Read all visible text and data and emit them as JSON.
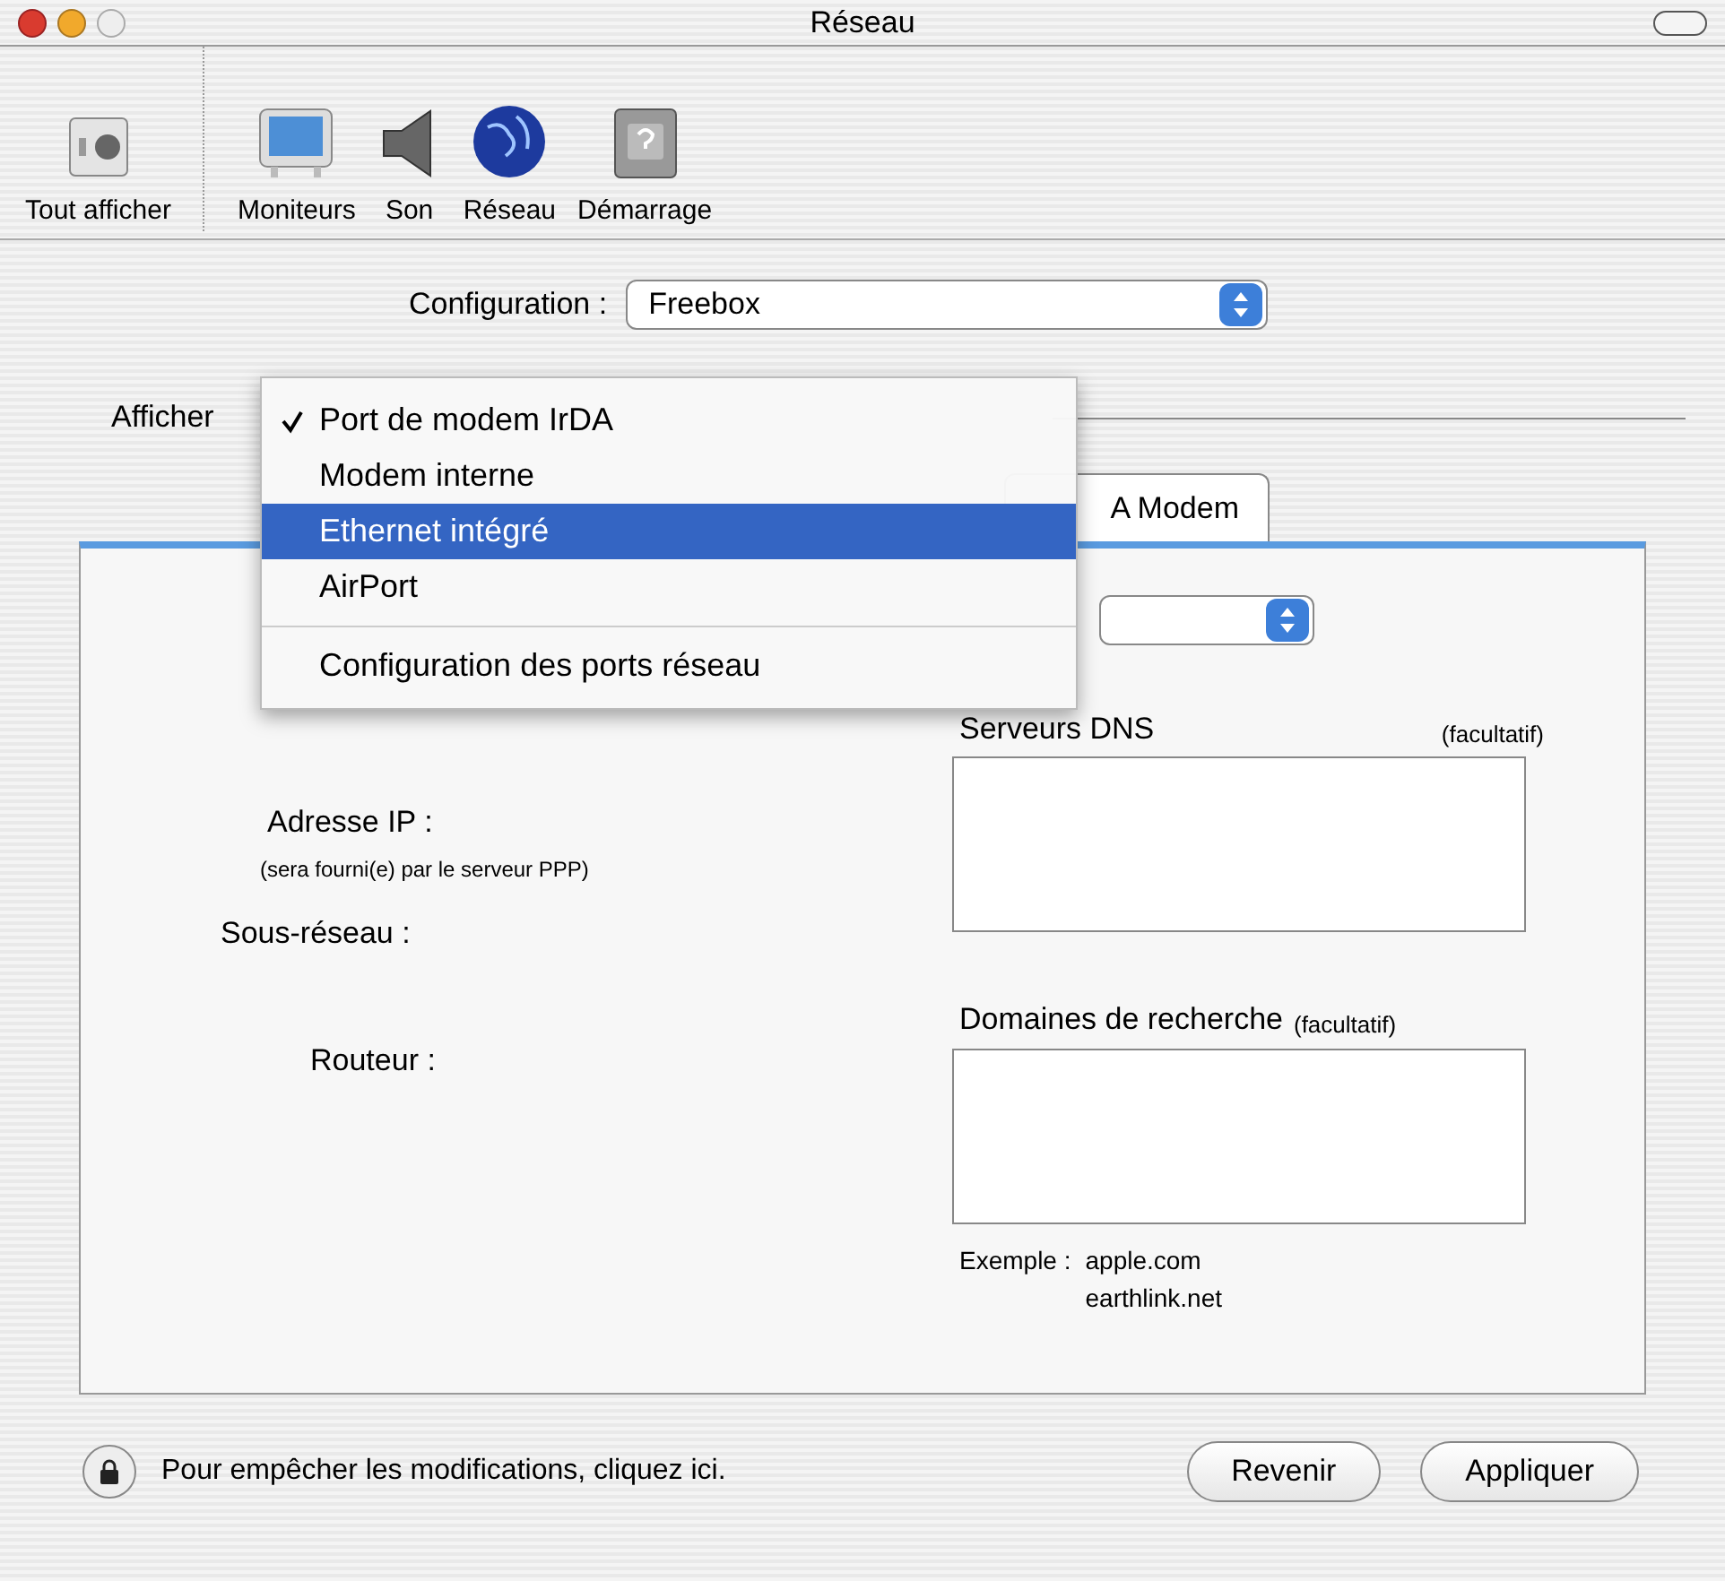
{
  "window": {
    "title": "Réseau"
  },
  "toolbar": {
    "items": [
      {
        "label": "Tout afficher",
        "kind": "general"
      },
      {
        "label": "Moniteurs",
        "kind": "monitor"
      },
      {
        "label": "Son",
        "kind": "speaker"
      },
      {
        "label": "Réseau",
        "kind": "globe"
      },
      {
        "label": "Démarrage",
        "kind": "disk"
      }
    ]
  },
  "configuration": {
    "label": "Configuration :",
    "value": "Freebox"
  },
  "show": {
    "label": "Afficher"
  },
  "menu": {
    "items": [
      {
        "label": "Port de modem IrDA",
        "checked": true,
        "selected": false
      },
      {
        "label": "Modem interne",
        "checked": false,
        "selected": false
      },
      {
        "label": "Ethernet intégré",
        "checked": false,
        "selected": true
      },
      {
        "label": "AirPort",
        "checked": false,
        "selected": false
      }
    ],
    "footer_item": {
      "label": "Configuration des ports réseau",
      "checked": false,
      "selected": false
    }
  },
  "tab": {
    "label": "A Modem",
    "selected": true
  },
  "form": {
    "ip_label": "Adresse IP :",
    "ip_note": "(sera fourni(e) par le serveur PPP)",
    "subnet_label": "Sous-réseau :",
    "router_label": "Routeur :",
    "dns": {
      "label": "Serveurs DNS",
      "optional": "(facultatif)"
    },
    "search_domains": {
      "label": "Domaines de recherche",
      "optional": "(facultatif)"
    },
    "example_label": "Exemple :",
    "examples": [
      "apple.com",
      "earthlink.net"
    ]
  },
  "footer": {
    "lock_text": "Pour empêcher les modifications, cliquez ici.",
    "buttons": [
      "Revenir",
      "Appliquer"
    ]
  }
}
